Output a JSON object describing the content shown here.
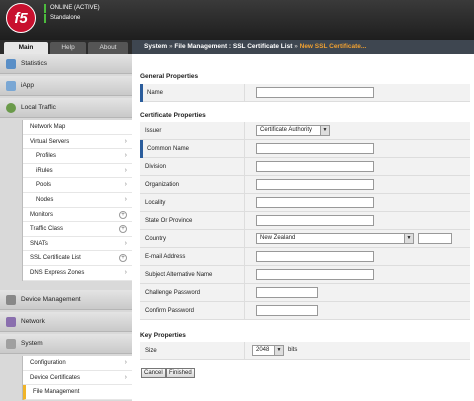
{
  "header": {
    "logo_text": "f5",
    "status_line1": "ONLINE (ACTIVE)",
    "status_line2": "Standalone"
  },
  "tabs": [
    {
      "label": "Main",
      "active": true
    },
    {
      "label": "Help",
      "active": false
    },
    {
      "label": "About",
      "active": false
    }
  ],
  "breadcrumb": {
    "part1": "System",
    "sep": "»",
    "part2": "File Management : SSL Certificate List",
    "part3": "New SSL Certificate..."
  },
  "sidebar": {
    "sections": {
      "statistics": "Statistics",
      "iapp": "iApp",
      "local_traffic": "Local Traffic",
      "device_management": "Device Management",
      "network": "Network",
      "system": "System"
    },
    "local_traffic_items": [
      "Network Map",
      "Virtual Servers",
      "Profiles",
      "iRules",
      "Pools",
      "Nodes",
      "Monitors",
      "Traffic Class",
      "SNATs",
      "SSL Certificate List",
      "DNS Express Zones"
    ],
    "system_items": [
      "Configuration",
      "Device Certificates",
      "File Management"
    ]
  },
  "form": {
    "general_title": "General Properties",
    "name_label": "Name",
    "cert_title": "Certificate Properties",
    "issuer_label": "Issuer",
    "issuer_value": "Certificate Authority",
    "common_name_label": "Common Name",
    "division_label": "Division",
    "organization_label": "Organization",
    "locality_label": "Locality",
    "state_label": "State Or Province",
    "country_label": "Country",
    "country_value": "New Zealand",
    "email_label": "E-mail Address",
    "san_label": "Subject Alternative Name",
    "challenge_label": "Challenge Password",
    "confirm_label": "Confirm Password",
    "key_title": "Key Properties",
    "size_label": "Size",
    "size_value": "2048",
    "size_unit": "bits",
    "cancel_label": "Cancel",
    "finished_label": "Finished"
  },
  "colors": {
    "accent_required": "#2b5d9c",
    "status_online": "#4cbb3d",
    "logo": "#c8102e",
    "breadcrumb_current": "#f0a030"
  }
}
